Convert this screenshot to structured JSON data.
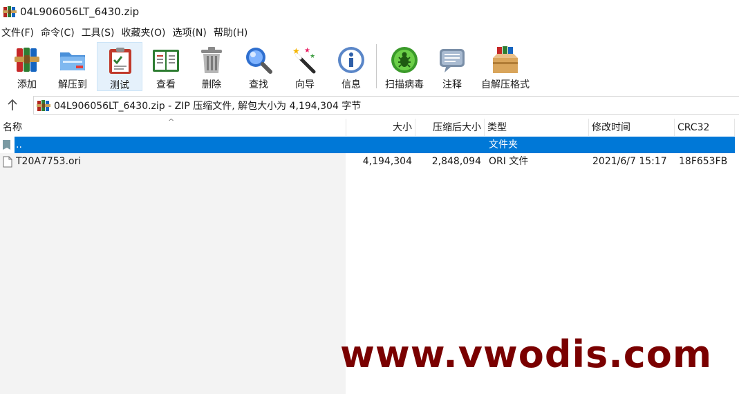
{
  "window": {
    "title": "04L906056LT_6430.zip",
    "app_icon": "winrar-books-icon"
  },
  "menu": [
    {
      "label": "文件(F)"
    },
    {
      "label": "命令(C)"
    },
    {
      "label": "工具(S)"
    },
    {
      "label": "收藏夹(O)"
    },
    {
      "label": "选项(N)"
    },
    {
      "label": "帮助(H)"
    }
  ],
  "toolbar": [
    {
      "label": "添加",
      "icon": "add-archive-icon"
    },
    {
      "label": "解压到",
      "icon": "extract-folder-icon"
    },
    {
      "label": "测试",
      "icon": "test-clipboard-icon",
      "active": true
    },
    {
      "label": "查看",
      "icon": "view-book-icon"
    },
    {
      "label": "删除",
      "icon": "trash-icon"
    },
    {
      "label": "查找",
      "icon": "magnifier-icon"
    },
    {
      "label": "向导",
      "icon": "wizard-wand-icon"
    },
    {
      "label": "信息",
      "icon": "info-icon"
    },
    {
      "label": "扫描病毒",
      "icon": "virus-scan-icon"
    },
    {
      "label": "注释",
      "icon": "comment-icon"
    },
    {
      "label": "自解压格式",
      "icon": "sfx-box-icon"
    }
  ],
  "address": {
    "text": "04L906056LT_6430.zip - ZIP 压缩文件, 解包大小为 4,194,304 字节"
  },
  "columns": {
    "name": "名称",
    "size": "大小",
    "packed": "压缩后大小",
    "type": "类型",
    "modified": "修改时间",
    "crc": "CRC32"
  },
  "rows": [
    {
      "name": "..",
      "size": "",
      "packed": "",
      "type": "文件夹",
      "modified": "",
      "crc": "",
      "selected": true,
      "icon": "parent-folder-icon"
    },
    {
      "name": "T20A7753.ori",
      "size": "4,194,304",
      "packed": "2,848,094",
      "type": "ORI 文件",
      "modified": "2021/6/7 15:17",
      "crc": "18F653FB",
      "selected": false,
      "icon": "file-icon"
    }
  ],
  "watermark": "www.vwodis.com",
  "colors": {
    "selection": "#0078d7",
    "watermark": "#7a0000"
  }
}
